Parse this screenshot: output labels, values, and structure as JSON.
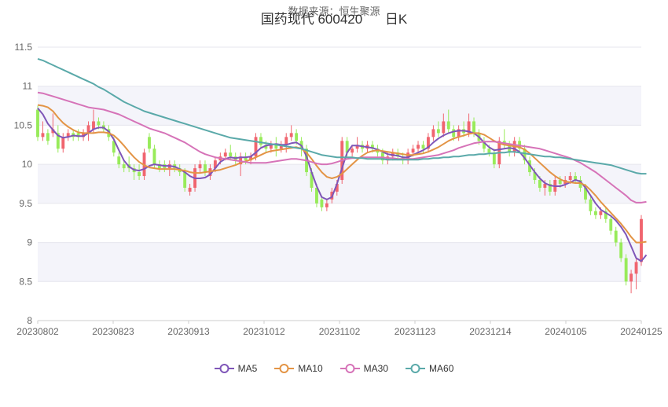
{
  "header": {
    "watermark": "数据来源：恒生聚源",
    "stock_name": "国药现代 600420",
    "period": "日K"
  },
  "colors": {
    "up": "#f0656f",
    "down": "#98eb5a",
    "ma5": "#7f56b8",
    "ma10": "#e39445",
    "ma30": "#d673b8",
    "ma60": "#5aa9a9",
    "grid_band": "#f4f4fa"
  },
  "chart_data": {
    "type": "candlestick",
    "x_tick_labels": [
      "20230802",
      "20230823",
      "20230913",
      "20231012",
      "20231102",
      "20231123",
      "20231214",
      "20240105",
      "20240125"
    ],
    "y_tick_labels": [
      "8",
      "8.5",
      "9",
      "9.5",
      "10",
      "10.5",
      "11",
      "11.5"
    ],
    "ylim": [
      8,
      11.5
    ],
    "bands": "alternating horizontal bands",
    "legend": {
      "position": "bottom",
      "items": [
        "MA5",
        "MA10",
        "MA30",
        "MA60"
      ]
    },
    "candles": {
      "note": "daily OHLC, approximated from the chart",
      "ohlc": [
        [
          10.7,
          10.75,
          10.3,
          10.35
        ],
        [
          10.35,
          10.55,
          10.3,
          10.4
        ],
        [
          10.4,
          10.45,
          10.25,
          10.3
        ],
        [
          10.4,
          10.65,
          10.35,
          10.45
        ],
        [
          10.4,
          10.5,
          10.15,
          10.2
        ],
        [
          10.2,
          10.4,
          10.15,
          10.35
        ],
        [
          10.35,
          10.45,
          10.3,
          10.4
        ],
        [
          10.4,
          10.45,
          10.3,
          10.35
        ],
        [
          10.4,
          10.45,
          10.3,
          10.35
        ],
        [
          10.35,
          10.45,
          10.3,
          10.4
        ],
        [
          10.4,
          10.55,
          10.3,
          10.5
        ],
        [
          10.45,
          10.7,
          10.4,
          10.55
        ],
        [
          10.55,
          10.6,
          10.45,
          10.5
        ],
        [
          10.5,
          10.55,
          10.4,
          10.45
        ],
        [
          10.45,
          10.5,
          10.3,
          10.35
        ],
        [
          10.3,
          10.35,
          10.1,
          10.15
        ],
        [
          10.1,
          10.15,
          9.95,
          10.0
        ],
        [
          10.0,
          10.05,
          9.9,
          9.95
        ],
        [
          10.0,
          10.1,
          9.9,
          9.95
        ],
        [
          9.95,
          10.0,
          9.8,
          9.9
        ],
        [
          9.9,
          10.0,
          9.8,
          9.85
        ],
        [
          9.85,
          10.2,
          9.8,
          10.15
        ],
        [
          10.35,
          10.4,
          10.15,
          10.2
        ],
        [
          10.2,
          10.25,
          9.95,
          10.0
        ],
        [
          10.0,
          10.05,
          9.9,
          9.95
        ],
        [
          10.0,
          10.05,
          9.9,
          9.95
        ],
        [
          9.95,
          10.05,
          9.85,
          10.0
        ],
        [
          10.0,
          10.05,
          9.9,
          9.95
        ],
        [
          9.95,
          10.0,
          9.85,
          9.9
        ],
        [
          9.9,
          9.95,
          9.65,
          9.7
        ],
        [
          9.65,
          9.75,
          9.6,
          9.7
        ],
        [
          9.7,
          10.0,
          9.65,
          9.95
        ],
        [
          9.95,
          10.05,
          9.9,
          10.0
        ],
        [
          10.0,
          10.05,
          9.85,
          9.9
        ],
        [
          9.85,
          10.0,
          9.8,
          9.95
        ],
        [
          9.95,
          10.1,
          9.9,
          10.05
        ],
        [
          10.05,
          10.15,
          10.0,
          10.1
        ],
        [
          10.1,
          10.2,
          10.05,
          10.15
        ],
        [
          10.15,
          10.25,
          10.05,
          10.1
        ],
        [
          10.1,
          10.15,
          10.0,
          10.05
        ],
        [
          10.0,
          10.15,
          9.85,
          10.1
        ],
        [
          10.1,
          10.15,
          10.0,
          10.05
        ],
        [
          10.05,
          10.15,
          10.0,
          10.1
        ],
        [
          10.1,
          10.4,
          10.05,
          10.35
        ],
        [
          10.35,
          10.4,
          10.2,
          10.25
        ],
        [
          10.25,
          10.3,
          10.15,
          10.2
        ],
        [
          10.2,
          10.3,
          10.15,
          10.25
        ],
        [
          10.25,
          10.35,
          10.1,
          10.2
        ],
        [
          10.2,
          10.3,
          10.15,
          10.25
        ],
        [
          10.25,
          10.4,
          10.15,
          10.35
        ],
        [
          10.35,
          10.5,
          10.3,
          10.4
        ],
        [
          10.4,
          10.45,
          10.25,
          10.3
        ],
        [
          10.3,
          10.35,
          10.1,
          10.2
        ],
        [
          10.2,
          10.25,
          9.85,
          9.9
        ],
        [
          9.9,
          9.95,
          9.65,
          9.7
        ],
        [
          9.7,
          9.75,
          9.45,
          9.5
        ],
        [
          9.55,
          9.6,
          9.4,
          9.45
        ],
        [
          9.45,
          9.55,
          9.4,
          9.5
        ],
        [
          9.55,
          9.7,
          9.5,
          9.65
        ],
        [
          9.65,
          9.8,
          9.6,
          9.75
        ],
        [
          9.8,
          10.35,
          9.75,
          10.3
        ],
        [
          10.3,
          10.35,
          10.1,
          10.15
        ],
        [
          10.15,
          10.25,
          10.1,
          10.2
        ],
        [
          10.2,
          10.35,
          10.15,
          10.25
        ],
        [
          10.25,
          10.3,
          10.15,
          10.2
        ],
        [
          10.2,
          10.3,
          10.15,
          10.25
        ],
        [
          10.25,
          10.3,
          10.15,
          10.2
        ],
        [
          10.2,
          10.25,
          10.1,
          10.15
        ],
        [
          10.15,
          10.2,
          10.0,
          10.05
        ],
        [
          10.05,
          10.15,
          10.0,
          10.1
        ],
        [
          10.1,
          10.2,
          10.05,
          10.15
        ],
        [
          10.15,
          10.2,
          10.05,
          10.1
        ],
        [
          10.1,
          10.15,
          10.0,
          10.05
        ],
        [
          10.05,
          10.2,
          10.0,
          10.15
        ],
        [
          10.15,
          10.25,
          10.1,
          10.2
        ],
        [
          10.2,
          10.3,
          10.15,
          10.25
        ],
        [
          10.25,
          10.3,
          10.15,
          10.2
        ],
        [
          10.2,
          10.4,
          10.15,
          10.35
        ],
        [
          10.35,
          10.5,
          10.3,
          10.45
        ],
        [
          10.45,
          10.55,
          10.35,
          10.4
        ],
        [
          10.4,
          10.65,
          10.35,
          10.55
        ],
        [
          10.55,
          10.7,
          10.4,
          10.45
        ],
        [
          10.45,
          10.5,
          10.3,
          10.35
        ],
        [
          10.35,
          10.5,
          10.3,
          10.45
        ],
        [
          10.45,
          10.55,
          10.35,
          10.4
        ],
        [
          10.4,
          10.65,
          10.35,
          10.55
        ],
        [
          10.55,
          10.6,
          10.35,
          10.4
        ],
        [
          10.4,
          10.45,
          10.25,
          10.3
        ],
        [
          10.3,
          10.35,
          10.15,
          10.2
        ],
        [
          10.2,
          10.25,
          10.1,
          10.15
        ],
        [
          10.15,
          10.2,
          9.95,
          10.0
        ],
        [
          10.0,
          10.35,
          9.95,
          10.3
        ],
        [
          10.3,
          10.45,
          10.2,
          10.25
        ],
        [
          10.25,
          10.3,
          10.1,
          10.15
        ],
        [
          10.15,
          10.35,
          10.1,
          10.3
        ],
        [
          10.3,
          10.35,
          10.15,
          10.2
        ],
        [
          10.2,
          10.25,
          10.0,
          10.05
        ],
        [
          10.05,
          10.1,
          9.85,
          9.9
        ],
        [
          9.9,
          9.95,
          9.75,
          9.8
        ],
        [
          9.8,
          9.85,
          9.65,
          9.7
        ],
        [
          9.7,
          9.8,
          9.6,
          9.75
        ],
        [
          9.75,
          9.8,
          9.6,
          9.65
        ],
        [
          9.65,
          9.85,
          9.6,
          9.8
        ],
        [
          9.8,
          9.85,
          9.7,
          9.75
        ],
        [
          9.75,
          9.85,
          9.7,
          9.8
        ],
        [
          9.8,
          9.9,
          9.75,
          9.85
        ],
        [
          9.85,
          9.9,
          9.75,
          9.8
        ],
        [
          9.8,
          9.85,
          9.65,
          9.7
        ],
        [
          9.7,
          9.75,
          9.5,
          9.55
        ],
        [
          9.55,
          9.6,
          9.35,
          9.4
        ],
        [
          9.4,
          9.45,
          9.3,
          9.35
        ],
        [
          9.35,
          9.45,
          9.3,
          9.4
        ],
        [
          9.4,
          9.45,
          9.25,
          9.3
        ],
        [
          9.3,
          9.35,
          9.1,
          9.15
        ],
        [
          9.15,
          9.2,
          8.95,
          9.0
        ],
        [
          9.0,
          9.05,
          8.75,
          8.8
        ],
        [
          8.8,
          8.85,
          8.45,
          8.5
        ],
        [
          8.5,
          8.65,
          8.35,
          8.6
        ],
        [
          8.6,
          8.8,
          8.4,
          8.75
        ],
        [
          8.75,
          9.35,
          8.7,
          9.3
        ]
      ]
    },
    "series": [
      {
        "name": "MA5",
        "values": [
          10.72,
          10.64,
          10.52,
          10.44,
          10.37,
          10.34,
          10.35,
          10.37,
          10.36,
          10.36,
          10.4,
          10.45,
          10.47,
          10.47,
          10.42,
          10.32,
          10.18,
          10.05,
          9.97,
          9.93,
          9.92,
          9.94,
          9.98,
          10.0,
          9.99,
          9.98,
          9.98,
          9.97,
          9.94,
          9.9,
          9.85,
          9.82,
          9.82,
          9.83,
          9.87,
          9.95,
          10.03,
          10.07,
          10.09,
          10.08,
          10.09,
          10.09,
          10.1,
          10.15,
          10.21,
          10.24,
          10.25,
          10.26,
          10.25,
          10.25,
          10.27,
          10.28,
          10.24,
          10.1,
          9.9,
          9.72,
          9.58,
          9.55,
          9.58,
          9.75,
          9.95,
          10.15,
          10.24,
          10.24,
          10.23,
          10.22,
          10.21,
          10.19,
          10.16,
          10.13,
          10.12,
          10.11,
          10.09,
          10.09,
          10.12,
          10.15,
          10.18,
          10.22,
          10.28,
          10.33,
          10.37,
          10.4,
          10.42,
          10.43,
          10.43,
          10.42,
          10.4,
          10.35,
          10.28,
          10.22,
          10.18,
          10.19,
          10.2,
          10.21,
          10.2,
          10.16,
          10.08,
          9.99,
          9.9,
          9.82,
          9.76,
          9.73,
          9.72,
          9.72,
          9.74,
          9.77,
          9.8,
          9.78,
          9.7,
          9.6,
          9.5,
          9.42,
          9.38,
          9.34,
          9.28,
          9.2,
          9.1,
          8.95,
          8.8,
          8.76,
          8.84
        ]
      },
      {
        "name": "MA10",
        "values": [
          10.76,
          10.75,
          10.73,
          10.68,
          10.6,
          10.53,
          10.48,
          10.44,
          10.41,
          10.4,
          10.4,
          10.4,
          10.41,
          10.41,
          10.4,
          10.37,
          10.31,
          10.24,
          10.16,
          10.09,
          10.03,
          9.99,
          9.96,
          9.95,
          9.94,
          9.94,
          9.94,
          9.94,
          9.93,
          9.92,
          9.9,
          9.89,
          9.89,
          9.9,
          9.91,
          9.92,
          9.93,
          9.95,
          9.97,
          9.99,
          10.02,
          10.04,
          10.06,
          10.09,
          10.12,
          10.15,
          10.17,
          10.18,
          10.19,
          10.2,
          10.21,
          10.22,
          10.2,
          10.15,
          10.07,
          9.98,
          9.9,
          9.84,
          9.82,
          9.84,
          9.88,
          9.94,
          10.0,
          10.06,
          10.11,
          10.15,
          10.17,
          10.18,
          10.17,
          10.16,
          10.15,
          10.14,
          10.13,
          10.12,
          10.12,
          10.13,
          10.14,
          10.16,
          10.19,
          10.22,
          10.26,
          10.3,
          10.33,
          10.35,
          10.37,
          10.39,
          10.4,
          10.4,
          10.38,
          10.34,
          10.3,
          10.27,
          10.25,
          10.24,
          10.23,
          10.22,
          10.19,
          10.14,
          10.08,
          10.02,
          9.96,
          9.9,
          9.85,
          9.81,
          9.78,
          9.77,
          9.76,
          9.76,
          9.73,
          9.67,
          9.6,
          9.52,
          9.45,
          9.38,
          9.31,
          9.24,
          9.16,
          9.07,
          9.0,
          9.0,
          9.01
        ]
      },
      {
        "name": "MA30",
        "values": [
          10.92,
          10.91,
          10.89,
          10.87,
          10.85,
          10.83,
          10.81,
          10.79,
          10.77,
          10.75,
          10.73,
          10.72,
          10.71,
          10.7,
          10.68,
          10.66,
          10.64,
          10.61,
          10.58,
          10.55,
          10.52,
          10.49,
          10.46,
          10.44,
          10.42,
          10.4,
          10.37,
          10.34,
          10.31,
          10.28,
          10.24,
          10.2,
          10.16,
          10.13,
          10.11,
          10.09,
          10.08,
          10.07,
          10.06,
          10.05,
          10.04,
          10.03,
          10.02,
          10.02,
          10.02,
          10.02,
          10.03,
          10.04,
          10.05,
          10.06,
          10.07,
          10.07,
          10.06,
          10.05,
          10.03,
          10.01,
          10.0,
          10.0,
          10.01,
          10.03,
          10.05,
          10.07,
          10.08,
          10.08,
          10.09,
          10.09,
          10.09,
          10.09,
          10.09,
          10.08,
          10.08,
          10.07,
          10.07,
          10.07,
          10.07,
          10.08,
          10.09,
          10.1,
          10.11,
          10.12,
          10.14,
          10.16,
          10.18,
          10.21,
          10.23,
          10.25,
          10.27,
          10.28,
          10.29,
          10.29,
          10.29,
          10.28,
          10.27,
          10.26,
          10.25,
          10.24,
          10.23,
          10.22,
          10.21,
          10.2,
          10.18,
          10.16,
          10.14,
          10.12,
          10.1,
          10.08,
          10.05,
          10.02,
          9.98,
          9.94,
          9.9,
          9.85,
          9.8,
          9.75,
          9.7,
          9.65,
          9.6,
          9.54,
          9.51,
          9.51,
          9.52
        ]
      },
      {
        "name": "MA60",
        "values": [
          11.35,
          11.33,
          11.3,
          11.27,
          11.24,
          11.21,
          11.18,
          11.15,
          11.12,
          11.09,
          11.06,
          11.03,
          10.99,
          10.96,
          10.92,
          10.88,
          10.84,
          10.8,
          10.77,
          10.74,
          10.71,
          10.68,
          10.66,
          10.64,
          10.62,
          10.6,
          10.58,
          10.56,
          10.54,
          10.52,
          10.5,
          10.48,
          10.46,
          10.44,
          10.42,
          10.4,
          10.38,
          10.36,
          10.34,
          10.33,
          10.32,
          10.31,
          10.3,
          10.29,
          10.28,
          10.27,
          10.26,
          10.25,
          10.24,
          10.23,
          10.22,
          10.21,
          10.2,
          10.18,
          10.16,
          10.14,
          10.12,
          10.11,
          10.1,
          10.09,
          10.09,
          10.09,
          10.09,
          10.08,
          10.08,
          10.07,
          10.07,
          10.07,
          10.07,
          10.06,
          10.06,
          10.06,
          10.06,
          10.06,
          10.06,
          10.06,
          10.07,
          10.07,
          10.08,
          10.08,
          10.09,
          10.09,
          10.1,
          10.1,
          10.11,
          10.12,
          10.12,
          10.13,
          10.13,
          10.14,
          10.14,
          10.15,
          10.15,
          10.16,
          10.16,
          10.15,
          10.14,
          10.13,
          10.12,
          10.11,
          10.1,
          10.1,
          10.09,
          10.09,
          10.08,
          10.07,
          10.06,
          10.05,
          10.04,
          10.03,
          10.02,
          10.01,
          10.0,
          9.99,
          9.97,
          9.95,
          9.93,
          9.91,
          9.89,
          9.88,
          9.88
        ]
      }
    ]
  }
}
